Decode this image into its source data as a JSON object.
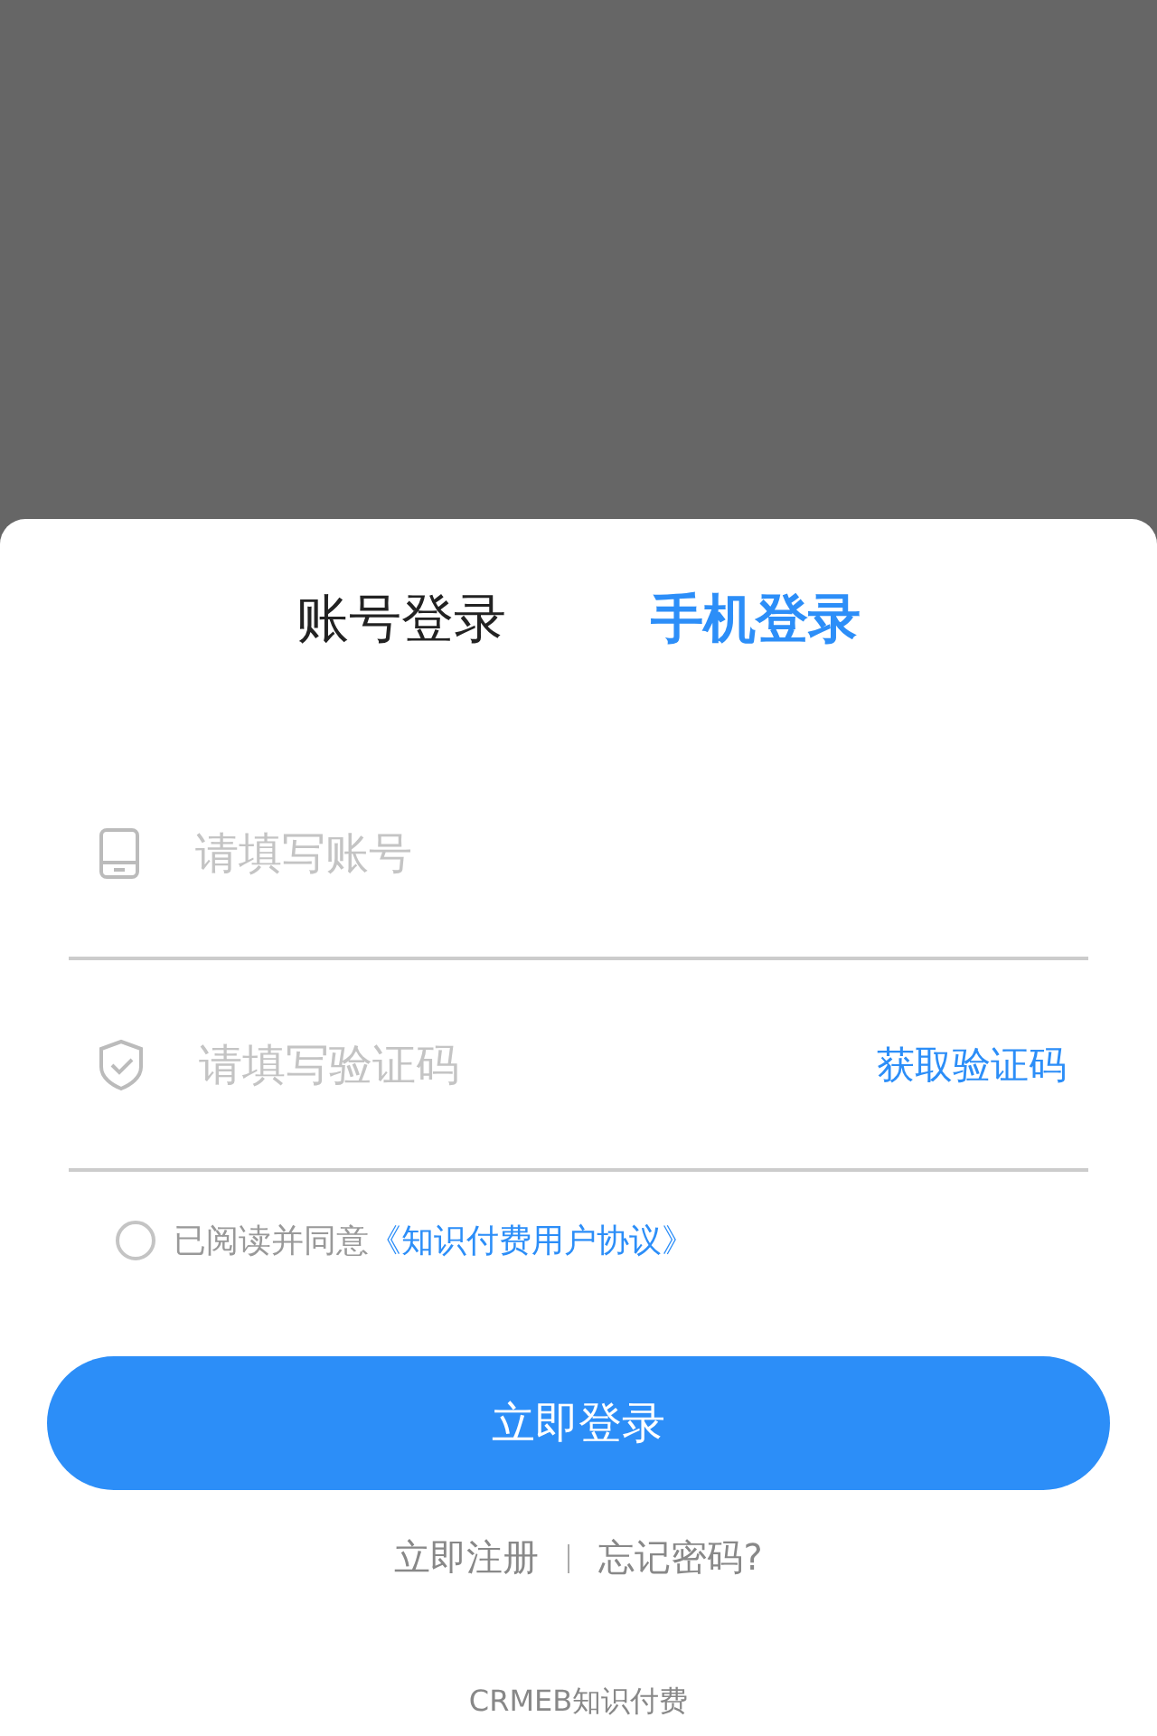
{
  "tabs": [
    {
      "label": "账号登录",
      "selected": false
    },
    {
      "label": "手机登录",
      "selected": true
    }
  ],
  "fields": [
    {
      "kind": "phone",
      "placeholder": "请填写账号"
    },
    {
      "kind": "code",
      "placeholder": "请填写验证码",
      "action": "获取验证码"
    }
  ],
  "agreement": {
    "checked": false,
    "text": "已阅读并同意",
    "link": "《知识付费用户协议》"
  },
  "submit": "立即登录",
  "links": [
    "立即注册",
    "忘记密码?"
  ],
  "footer": "CRMEB知识付费"
}
